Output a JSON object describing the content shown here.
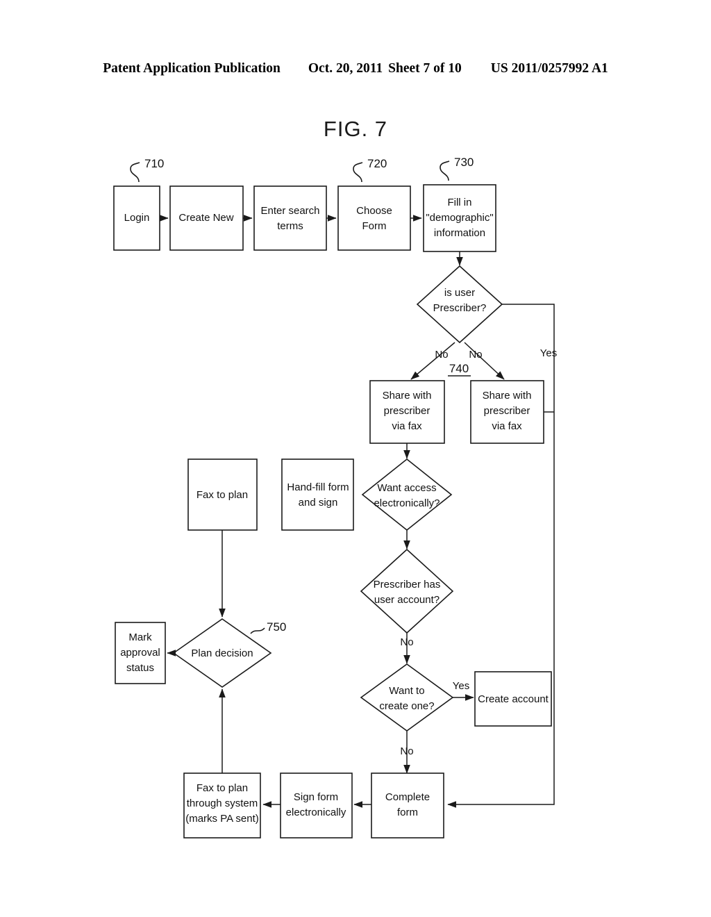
{
  "header": {
    "publication": "Patent Application Publication",
    "date": "Oct. 20, 2011",
    "sheet": "Sheet 7 of 10",
    "number": "US 2011/0257992 A1"
  },
  "figure": {
    "title": "FIG. 7"
  },
  "reference_numerals": {
    "login": "710",
    "choose_form": "720",
    "fill_demographic": "730",
    "share_fax": "740",
    "plan_decision": "750"
  },
  "nodes": {
    "login": "Login",
    "create_new": "Create New",
    "enter_search_terms_1": "Enter search",
    "enter_search_terms_2": "terms",
    "choose_form_1": "Choose",
    "choose_form_2": "Form",
    "fill_demo_1": "Fill in",
    "fill_demo_2": "\"demographic\"",
    "fill_demo_3": "information",
    "is_user_prescriber_1": "is user",
    "is_user_prescriber_2": "Prescriber?",
    "share_fax_left_1": "Share with",
    "share_fax_left_2": "prescriber",
    "share_fax_left_3": "via fax",
    "share_fax_right_1": "Share with",
    "share_fax_right_2": "prescriber",
    "share_fax_right_3": "via fax",
    "fax_to_plan": "Fax to plan",
    "hand_fill_1": "Hand-fill form",
    "hand_fill_2": "and sign",
    "want_access_1": "Want access",
    "want_access_2": "electronically?",
    "prescriber_account_1": "Prescriber has",
    "prescriber_account_2": "user account?",
    "mark_approval_1": "Mark",
    "mark_approval_2": "approval",
    "mark_approval_3": "status",
    "plan_decision": "Plan decision",
    "want_create_one_1": "Want to",
    "want_create_one_2": "create one?",
    "create_account": "Create account",
    "fax_through_system_1": "Fax to plan",
    "fax_through_system_2": "through system",
    "fax_through_system_3": "(marks PA sent)",
    "sign_electronically_1": "Sign form",
    "sign_electronically_2": "electronically",
    "complete_form_1": "Complete",
    "complete_form_2": "form"
  },
  "edge_labels": {
    "prescriber_no_left": "No",
    "prescriber_no_right": "No",
    "prescriber_yes": "Yes",
    "account_no": "No",
    "create_one_yes": "Yes",
    "create_one_no": "No"
  },
  "colors": {
    "ink": "#1a1a1a",
    "paper": "#ffffff"
  }
}
